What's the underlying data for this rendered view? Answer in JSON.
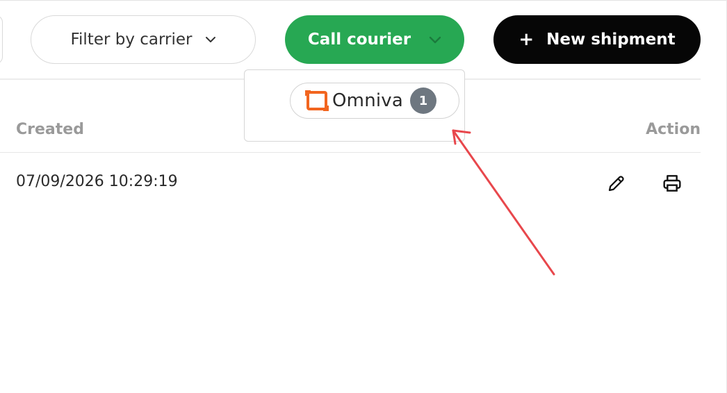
{
  "toolbar": {
    "filter_label": "Filter by carrier",
    "call_courier_label": "Call courier",
    "new_shipment_plus": "+",
    "new_shipment_label": "New shipment"
  },
  "courier_dropdown": {
    "carriers": [
      {
        "name": "Omniva",
        "count": "1",
        "logo_icon": "omniva-logo"
      }
    ]
  },
  "table": {
    "columns": {
      "created": "Created",
      "action": "Action"
    },
    "rows": [
      {
        "created": "07/09/2026 10:29:19",
        "actions": [
          "edit-icon",
          "print-icon"
        ]
      }
    ]
  },
  "colors": {
    "call_courier_bg": "#27a853",
    "new_shipment_bg": "#060606",
    "omniva_orange": "#f2651f",
    "badge_gray": "#6e7780",
    "annotation_red": "#e8474c"
  }
}
